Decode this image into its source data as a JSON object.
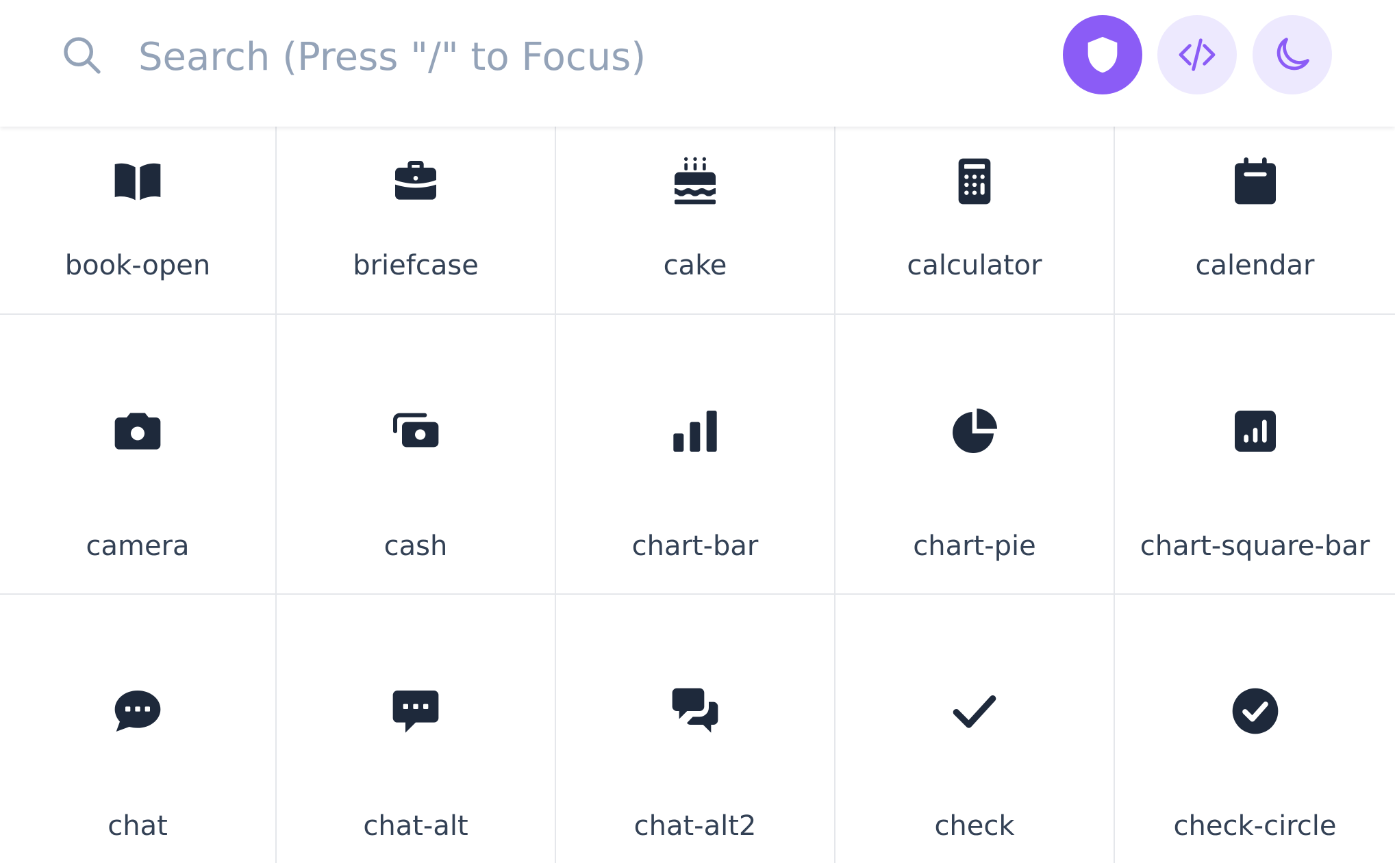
{
  "search": {
    "placeholder": "Search (Press \"/\" to Focus)",
    "value": ""
  },
  "header_buttons": [
    {
      "icon": "shield-icon",
      "active": true
    },
    {
      "icon": "code-icon",
      "active": false
    },
    {
      "icon": "moon-icon",
      "active": false
    }
  ],
  "colors": {
    "accent": "#8b5cf6",
    "accent_light": "#ede9fe",
    "icon": "#1e293b",
    "label": "#334155",
    "placeholder": "#94a3b8",
    "border": "#e5e7eb"
  },
  "icons": [
    {
      "name": "book-open"
    },
    {
      "name": "briefcase"
    },
    {
      "name": "cake"
    },
    {
      "name": "calculator"
    },
    {
      "name": "calendar"
    },
    {
      "name": "camera"
    },
    {
      "name": "cash"
    },
    {
      "name": "chart-bar"
    },
    {
      "name": "chart-pie"
    },
    {
      "name": "chart-square-bar"
    },
    {
      "name": "chat"
    },
    {
      "name": "chat-alt"
    },
    {
      "name": "chat-alt2"
    },
    {
      "name": "check"
    },
    {
      "name": "check-circle"
    }
  ]
}
